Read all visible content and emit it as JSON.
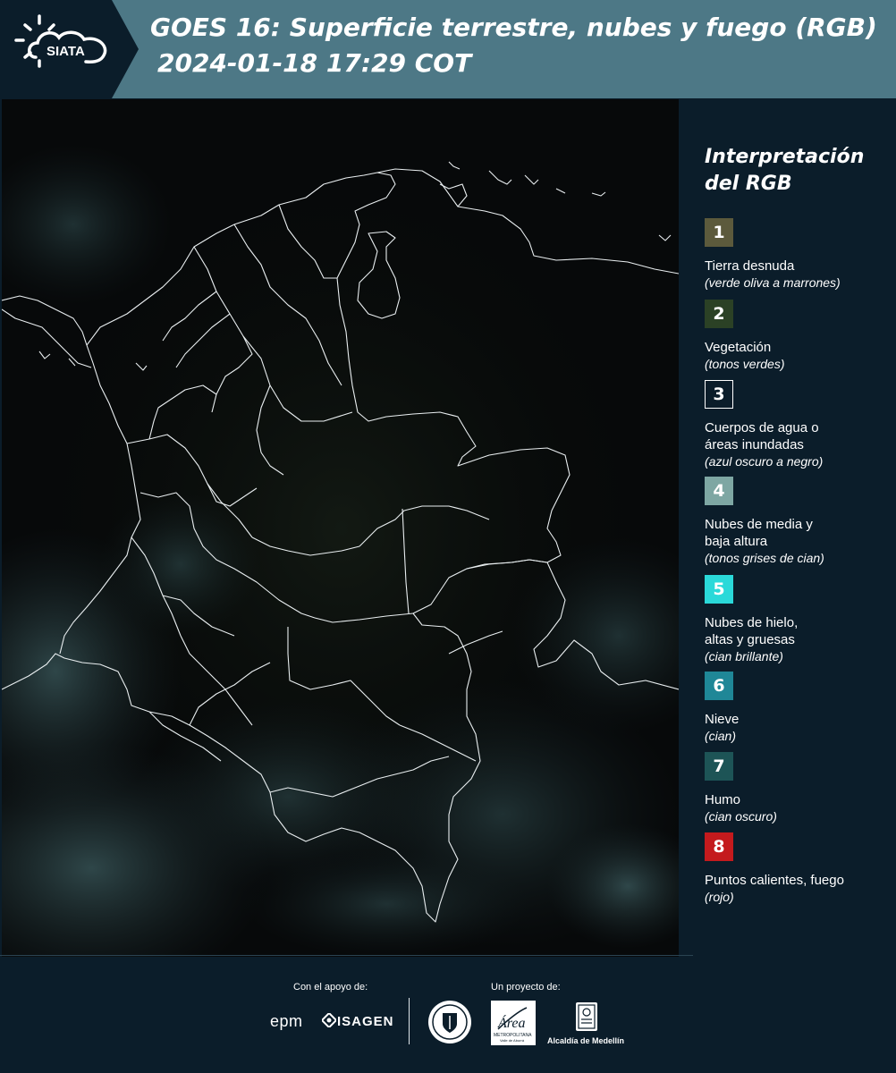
{
  "header": {
    "logo_text": "SIATA",
    "title_line1": "GOES 16: Superficie terrestre, nubes y fuego (RGB)",
    "title_line2": "2024-01-18 17:29 COT"
  },
  "map": {
    "description_icon": "satellite-map-colombia"
  },
  "legend": {
    "title": "Interpretación del RGB",
    "items": [
      {
        "number": "1",
        "label": "Tierra desnuda",
        "hint": "(verde oliva a marrones)",
        "color": "#5c5a3c"
      },
      {
        "number": "2",
        "label": "Vegetación",
        "hint": "(tonos verdes)",
        "color": "#2b4125"
      },
      {
        "number": "3",
        "label": "Cuerpos de agua o\náreas inundadas",
        "hint": "(azul oscuro a negro)",
        "color": "#0b1d2a"
      },
      {
        "number": "4",
        "label": "Nubes de media y\nbaja altura",
        "hint": "(tonos grises de cian)",
        "color": "#7ea7a3"
      },
      {
        "number": "5",
        "label": "Nubes de hielo,\naltas y gruesas",
        "hint": "(cian brillante)",
        "color": "#2ad9d9"
      },
      {
        "number": "6",
        "label": "Nieve",
        "hint": "(cian)",
        "color": "#1f8797"
      },
      {
        "number": "7",
        "label": "Humo",
        "hint": "(cian oscuro)",
        "color": "#1d5456"
      },
      {
        "number": "8",
        "label": "Puntos calientes, fuego",
        "hint": "(rojo)",
        "color": "#c41a1d"
      }
    ]
  },
  "footer": {
    "support_label": "Con el apoyo de:",
    "project_label": "Un proyecto de:",
    "epm": "epm",
    "isagen": "ISAGEN",
    "area_logo_text": "Área",
    "area_logo_sub": "METROPOLITANA",
    "area_logo_sub2": "Valle de Aburrá",
    "alcaldia": "Alcaldía de Medellín"
  }
}
